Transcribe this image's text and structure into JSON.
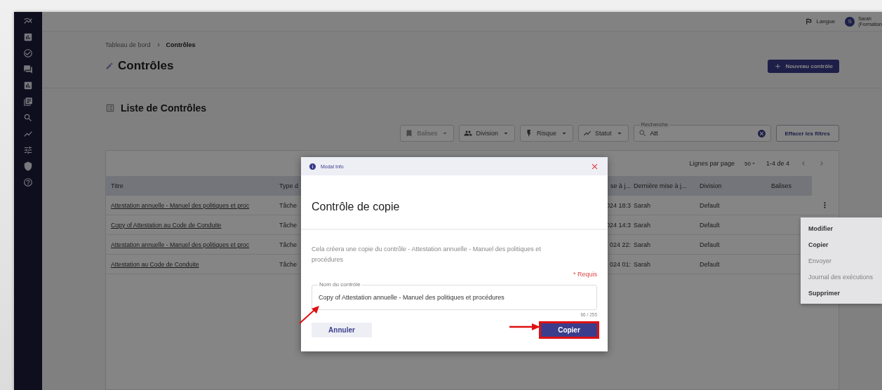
{
  "topbar": {
    "language": "Langue",
    "avatar_initial": "S",
    "user_name": "Sarah",
    "user_detail": "(Formation"
  },
  "breadcrumb": [
    {
      "label": "Tableau de bord",
      "current": false
    },
    {
      "label": "Contrôles",
      "current": true
    }
  ],
  "page": {
    "title": "Contrôles",
    "new_button": "Nouveau contrôle"
  },
  "list": {
    "title": "Liste de Contrôles",
    "filters": [
      {
        "label": "Balises",
        "disabled": true
      },
      {
        "label": "Division",
        "disabled": false
      },
      {
        "label": "Risque",
        "disabled": false
      },
      {
        "label": "Statut",
        "disabled": false
      }
    ],
    "search": {
      "label": "Recherche",
      "value": "Att"
    },
    "clear_button": "Effacer les filtres",
    "pagination": {
      "rows_label": "Lignes par page",
      "rows_value": "50",
      "range": "1-4 de 4"
    },
    "columns": [
      "Titre",
      "Type d",
      "se à j...",
      "Dernière mise à j...",
      "Division",
      "Balises"
    ],
    "rows": [
      {
        "title": "Attestation annuelle - Manuel des politiques et proc",
        "type": "Tâche",
        "updated": "024 18:3",
        "updated_by": "Sarah",
        "division": "Default"
      },
      {
        "title": "Copy of Attestation au Code de Conduite",
        "type": "Tâche",
        "updated": "024 14:3",
        "updated_by": "Sarah",
        "division": "Default"
      },
      {
        "title": "Attestation annuelle - Manuel des politiques et proc",
        "type": "Tâche",
        "updated": "024 22:",
        "updated_by": "Sarah",
        "division": "Default"
      },
      {
        "title": "Attestation au Code de Conduite",
        "type": "Tâche",
        "updated": "024 01:",
        "updated_by": "Sarah",
        "division": "Default"
      }
    ]
  },
  "menu": [
    {
      "label": "Modifier",
      "disabled": false
    },
    {
      "label": "Copier",
      "disabled": false
    },
    {
      "label": "Envoyer",
      "disabled": true
    },
    {
      "label": "Journal des exécutions",
      "disabled": true
    },
    {
      "label": "Supprimer",
      "disabled": false
    }
  ],
  "modal": {
    "header": "Modal Info",
    "title": "Contrôle de copie",
    "description": "Cela créera une copie du contrôle - Attestation annuelle - Manuel des politiques et procédures",
    "required": "* Requis",
    "field": {
      "label": "Nom du contrôle",
      "value": "Copy of Attestation annuelle - Manuel des politiques et procédures",
      "counter": "66 / 255"
    },
    "cancel_button": "Annuler",
    "copy_button": {
      "label": "Copier",
      "highlighted": true
    }
  }
}
